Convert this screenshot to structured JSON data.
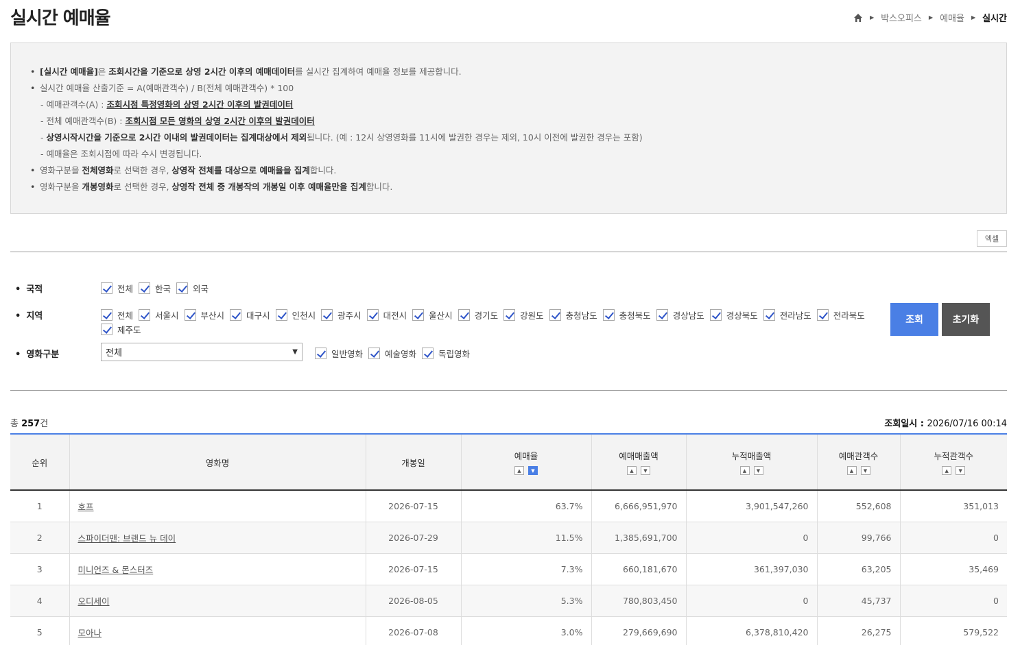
{
  "page": {
    "title": "실시간 예매율"
  },
  "breadcrumb": {
    "items": [
      "박스오피스",
      "예매율"
    ],
    "current": "실시간"
  },
  "info": {
    "l1": {
      "a": "[실시간 예매율]",
      "b": "은 ",
      "c": "조회시간을 기준으로 상영 2시간 이후의 예매데이터",
      "d": "를 실시간 집계하여 예매율 정보를 제공합니다."
    },
    "l2": "실시간 예매율 산출기준 = A(예매관객수) / B(전체 예매관객수) * 100",
    "l3": {
      "a": "- 예매관객수(A) : ",
      "b": "조회시점 특정영화의 상영 2시간 이후의 발권데이터"
    },
    "l4": {
      "a": "- 전체 예매관객수(B) : ",
      "b": "조회시점 모든 영화의 상영 2시간 이후의 발권데이터"
    },
    "l5": {
      "a": "- ",
      "b": "상영시작시간을 기준으로 2시간 이내의 발권데이터는 집계대상에서 제외",
      "c": "됩니다. (예 : 12시 상영영화를 11시에 발권한 경우는 제외, 10시 이전에 발권한 경우는 포함)"
    },
    "l6": "- 예매율은 조회시점에 따라 수시 변경됩니다.",
    "l7": {
      "a": "영화구분을 ",
      "b": "전체영화",
      "c": "로 선택한 경우, ",
      "d": "상영작 전체를 대상으로 예매율을 집계",
      "e": "합니다."
    },
    "l8": {
      "a": "영화구분을 ",
      "b": "개봉영화",
      "c": "로 선택한 경우, ",
      "d": "상영작 전체 중 개봉작의 개봉일 이후 예매율만을 집계",
      "e": "합니다."
    }
  },
  "excel_label": "엑셀",
  "filters": {
    "nationality": {
      "label": "국적",
      "options": [
        "전체",
        "한국",
        "외국"
      ]
    },
    "region": {
      "label": "지역",
      "options": [
        "전체",
        "서울시",
        "부산시",
        "대구시",
        "인천시",
        "광주시",
        "대전시",
        "울산시",
        "경기도",
        "강원도",
        "충청남도",
        "충청북도",
        "경상남도",
        "경상북도",
        "전라남도",
        "전라북도",
        "제주도"
      ]
    },
    "movie_type": {
      "label": "영화구분",
      "selected": "전체",
      "options": [
        "일반영화",
        "예술영화",
        "독립영화"
      ]
    }
  },
  "buttons": {
    "search": "조회",
    "reset": "초기화"
  },
  "summary": {
    "total_prefix": "총 ",
    "total_count": "257",
    "total_suffix": "건",
    "query_label": "조회일시 : ",
    "query_value": "2026/07/16 00:14"
  },
  "table": {
    "headers": [
      "순위",
      "영화명",
      "개봉일",
      "예매율",
      "예매매출액",
      "누적매출액",
      "예매관객수",
      "누적관객수"
    ],
    "rows": [
      [
        "1",
        "호프",
        "2026-07-15",
        "63.7%",
        "6,666,951,970",
        "3,901,547,260",
        "552,608",
        "351,013"
      ],
      [
        "2",
        "스파이더맨: 브랜드 뉴 데이",
        "2026-07-29",
        "11.5%",
        "1,385,691,700",
        "0",
        "99,766",
        "0"
      ],
      [
        "3",
        "미니언즈 & 몬스터즈",
        "2026-07-15",
        "7.3%",
        "660,181,670",
        "361,397,030",
        "63,205",
        "35,469"
      ],
      [
        "4",
        "오디세이",
        "2026-08-05",
        "5.3%",
        "780,803,450",
        "0",
        "45,737",
        "0"
      ],
      [
        "5",
        "모아나",
        "2026-07-08",
        "3.0%",
        "279,669,690",
        "6,378,810,420",
        "26,275",
        "579,522"
      ]
    ]
  },
  "colors": {
    "accent": "#4a7fe5",
    "reset": "#555555"
  }
}
